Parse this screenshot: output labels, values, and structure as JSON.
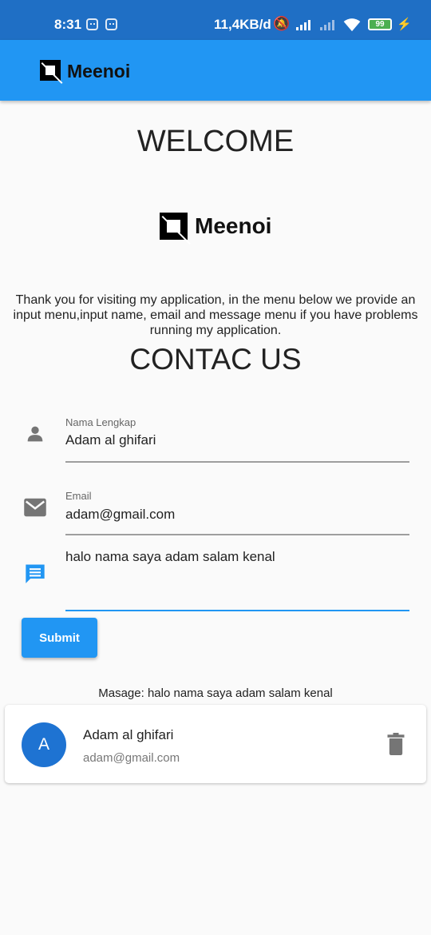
{
  "status_bar": {
    "time": "8:31",
    "network_speed": "11,4KB/d",
    "battery": "99",
    "icons": [
      "app-notification-icon",
      "app-notification-icon",
      "bell-muted-icon",
      "signal-icon",
      "signal-icon",
      "wifi-icon",
      "battery-icon",
      "charging-icon"
    ]
  },
  "app_bar": {
    "title": "Meenoi",
    "logo_icon": "meenoi-logo-icon"
  },
  "welcome": {
    "title": "WELCOME",
    "logo_text": "Meenoi"
  },
  "intro_text": "Thank you for visiting my application, in the menu below we provide an input menu,input name, email and message menu if you have problems running my application.",
  "contact_title": "CONTAC US",
  "form": {
    "name": {
      "label": "Nama Lengkap",
      "value": "Adam al ghifari",
      "icon": "person-icon"
    },
    "email": {
      "label": "Email",
      "value": "adam@gmail.com",
      "icon": "mail-icon"
    },
    "message": {
      "value": "halo nama saya adam salam kenal",
      "icon": "message-icon"
    },
    "submit_label": "Submit"
  },
  "message_display": "Masage: halo nama saya adam salam kenal",
  "contact_card": {
    "avatar_letter": "A",
    "name": "Adam al ghifari",
    "email": "adam@gmail.com",
    "delete_icon": "trash-icon"
  },
  "colors": {
    "primary": "#2196f3",
    "status_bar": "#1f6fc5",
    "avatar": "#1e73d2",
    "icon_gray": "#757575"
  }
}
